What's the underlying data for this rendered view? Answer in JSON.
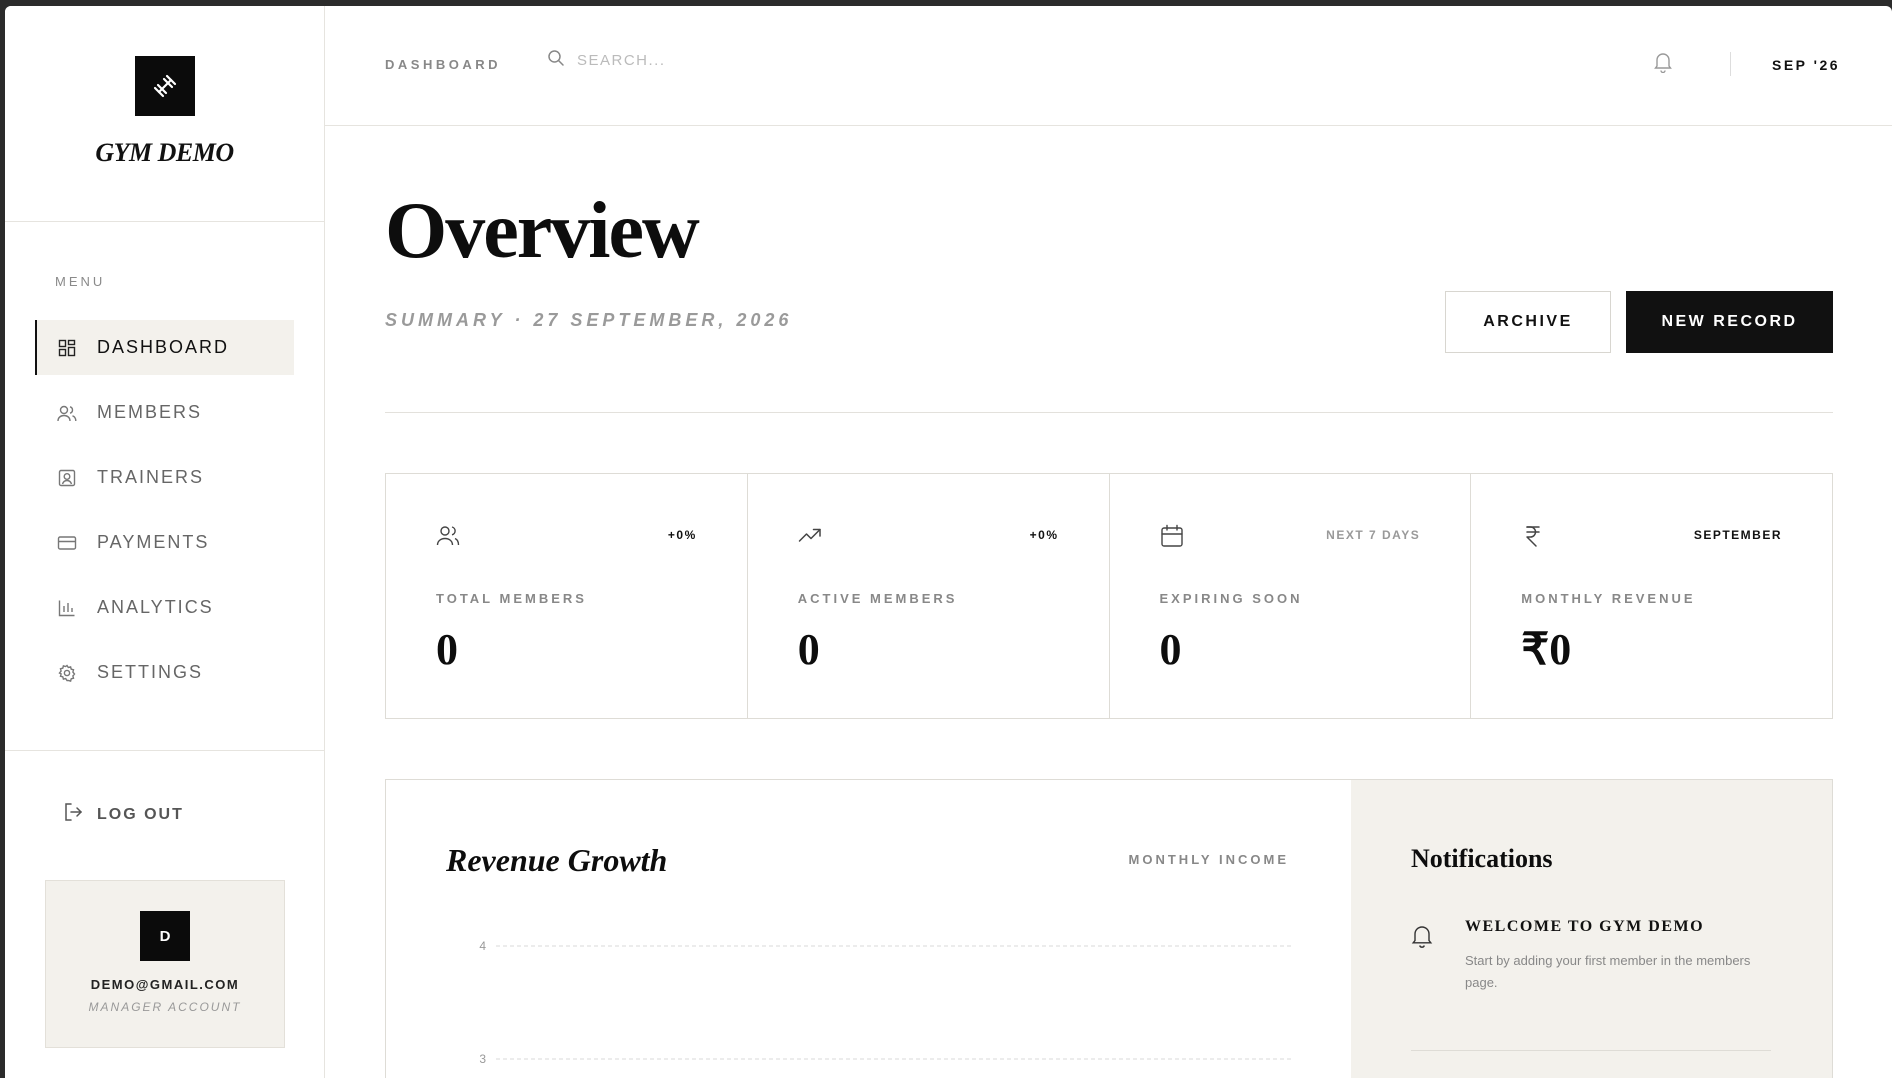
{
  "brand": {
    "name": "GYM DEMO",
    "logo_icon": "dumbbell-icon"
  },
  "sidebar": {
    "menu_label": "MENU",
    "items": [
      {
        "label": "DASHBOARD",
        "icon": "dashboard-icon",
        "active": true
      },
      {
        "label": "MEMBERS",
        "icon": "users-icon",
        "active": false
      },
      {
        "label": "TRAINERS",
        "icon": "id-badge-icon",
        "active": false
      },
      {
        "label": "PAYMENTS",
        "icon": "credit-card-icon",
        "active": false
      },
      {
        "label": "ANALYTICS",
        "icon": "bar-chart-icon",
        "active": false
      },
      {
        "label": "SETTINGS",
        "icon": "gear-icon",
        "active": false
      }
    ],
    "logout_label": "LOG OUT",
    "account": {
      "initial": "D",
      "email": "DEMO@GMAIL.COM",
      "role": "MANAGER ACCOUNT"
    }
  },
  "topbar": {
    "breadcrumb": "DASHBOARD",
    "search_placeholder": "SEARCH...",
    "search_value": "",
    "date_chip": "SEP '26"
  },
  "main": {
    "title": "Overview",
    "subtitle": "SUMMARY · 27 SEPTEMBER, 2026",
    "archive_label": "ARCHIVE",
    "new_record_label": "NEW RECORD",
    "stats": [
      {
        "icon": "users-icon",
        "badge": "+0%",
        "label": "TOTAL MEMBERS",
        "value": "0"
      },
      {
        "icon": "trending-up-icon",
        "badge": "+0%",
        "label": "ACTIVE MEMBERS",
        "value": "0"
      },
      {
        "icon": "calendar-icon",
        "badge": "NEXT 7 DAYS",
        "label": "EXPIRING SOON",
        "value": "0"
      },
      {
        "icon": "rupee-icon",
        "badge": "SEPTEMBER",
        "label": "MONTHLY REVENUE",
        "value": "₹0"
      }
    ],
    "chart": {
      "title": "Revenue Growth",
      "subtitle": "MONTHLY INCOME"
    },
    "notifications": {
      "title": "Notifications",
      "items": [
        {
          "title": "WELCOME TO GYM DEMO",
          "body": "Start by adding your first member in the members page."
        }
      ]
    }
  },
  "chart_data": {
    "type": "line",
    "title": "Revenue Growth",
    "subtitle": "MONTHLY INCOME",
    "y_ticks": [
      "4",
      "3"
    ],
    "grid": true,
    "series": []
  },
  "colors": {
    "accent": "#111111",
    "muted_bg": "#f3f1ec",
    "border": "#dedcd6"
  }
}
